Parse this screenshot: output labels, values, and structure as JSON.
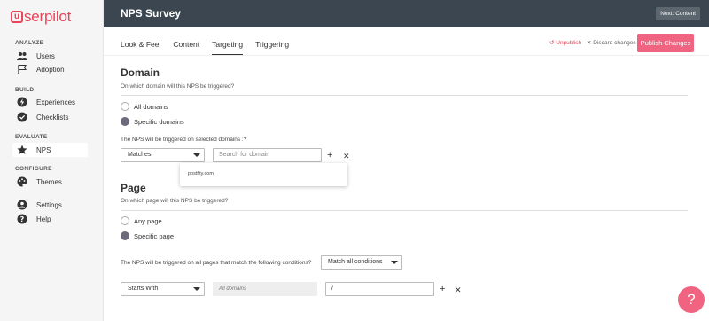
{
  "app": {
    "logo_text": "serpilot",
    "logo_mark": "u",
    "brand_color": "#e8445a"
  },
  "sidebar": {
    "sections": [
      {
        "label": "ANALYZE",
        "items": [
          {
            "label": "Users",
            "icon": "users-icon"
          },
          {
            "label": "Adoption",
            "icon": "flag-icon"
          }
        ]
      },
      {
        "label": "BUILD",
        "items": [
          {
            "label": "Experiences",
            "icon": "bolt-icon"
          },
          {
            "label": "Checklists",
            "icon": "checklist-icon"
          }
        ]
      },
      {
        "label": "EVALUATE",
        "items": [
          {
            "label": "NPS",
            "icon": "star-icon",
            "active": true
          }
        ]
      },
      {
        "label": "CONFIGURE",
        "items": [
          {
            "label": "Themes",
            "icon": "palette-icon"
          }
        ]
      }
    ],
    "bottom_items": [
      {
        "label": "Settings",
        "icon": "person-icon"
      },
      {
        "label": "Help",
        "icon": "question-icon"
      }
    ]
  },
  "header": {
    "title": "NPS Survey",
    "next_button": "Next: Content"
  },
  "tabs": [
    {
      "label": "Look & Feel",
      "active": false
    },
    {
      "label": "Content",
      "active": false
    },
    {
      "label": "Targeting",
      "active": true
    },
    {
      "label": "Triggering",
      "active": false
    }
  ],
  "actions": {
    "unpublish": "↺ Unpublish",
    "discard": "✕ Discard changes",
    "publish": "Publish Changes",
    "publish_color": "#f06381"
  },
  "domain": {
    "heading": "Domain",
    "subtitle": "On which domain will this NPS be triggered?",
    "options": [
      {
        "label": "All domains",
        "checked": false
      },
      {
        "label": "Specific domains",
        "checked": true
      }
    ],
    "info": "The NPS will be triggered on selected domains :?",
    "match_select": "Matches",
    "search_placeholder": "Search for domain",
    "dropdown_items": [
      "postfity.com"
    ]
  },
  "page": {
    "heading": "Page",
    "subtitle": "On which page will this NPS be triggered?",
    "options": [
      {
        "label": "Any page",
        "checked": false
      },
      {
        "label": "Specific page",
        "checked": true
      }
    ],
    "info": "The NPS will be triggered on all pages that match the following conditions?",
    "conditions_select": "Match all conditions",
    "rule_select": "Starts With",
    "rule_domain": "All domains",
    "rule_value": "/"
  },
  "help_fab": "?"
}
